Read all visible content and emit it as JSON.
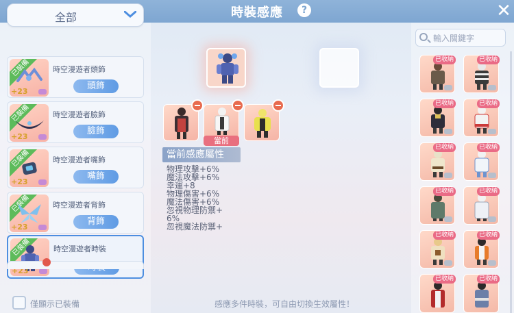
{
  "header": {
    "title": "時裝感應",
    "help_icon": "question-mark-icon",
    "close_icon": "close-icon"
  },
  "left": {
    "category": "全部",
    "items": [
      {
        "name": "時空漫遊者頭飾",
        "slot": "頭飾",
        "equipped": "已裝備",
        "bonus": "+23"
      },
      {
        "name": "時空漫遊者臉飾",
        "slot": "臉飾",
        "equipped": "已裝備",
        "bonus": "+23"
      },
      {
        "name": "時空漫遊者嘴飾",
        "slot": "嘴飾",
        "equipped": "已裝備",
        "bonus": "+23"
      },
      {
        "name": "時空漫遊者背飾",
        "slot": "背飾",
        "equipped": "已裝備",
        "bonus": "+23"
      },
      {
        "name": "時空漫遊者時裝",
        "slot": "時裝",
        "equipped": "已裝備",
        "bonus": "+23"
      }
    ],
    "show_equipped_label": "僅顯示已裝備"
  },
  "center": {
    "current_tag": "當前",
    "attr_header": "當前感應屬性",
    "attributes": [
      "物理攻擊+6%",
      "魔法攻擊+6%",
      "幸運+8",
      "物理傷害+6%",
      "魔法傷害+6%",
      "忽視物理防禦+",
      "6%",
      "忽視魔法防禦+"
    ],
    "footer_tip": "感應多件時裝，可自由切換生效屬性！"
  },
  "right": {
    "search_placeholder": "輸入關鍵字",
    "collected_label": "已收納"
  },
  "colors": {
    "header": "#7ea6d1",
    "accent_blue": "#4d8ee0",
    "equipped_green": "#5dbb5b",
    "collected_pink": "#ea6b86",
    "remove_red": "#e86b4f"
  }
}
